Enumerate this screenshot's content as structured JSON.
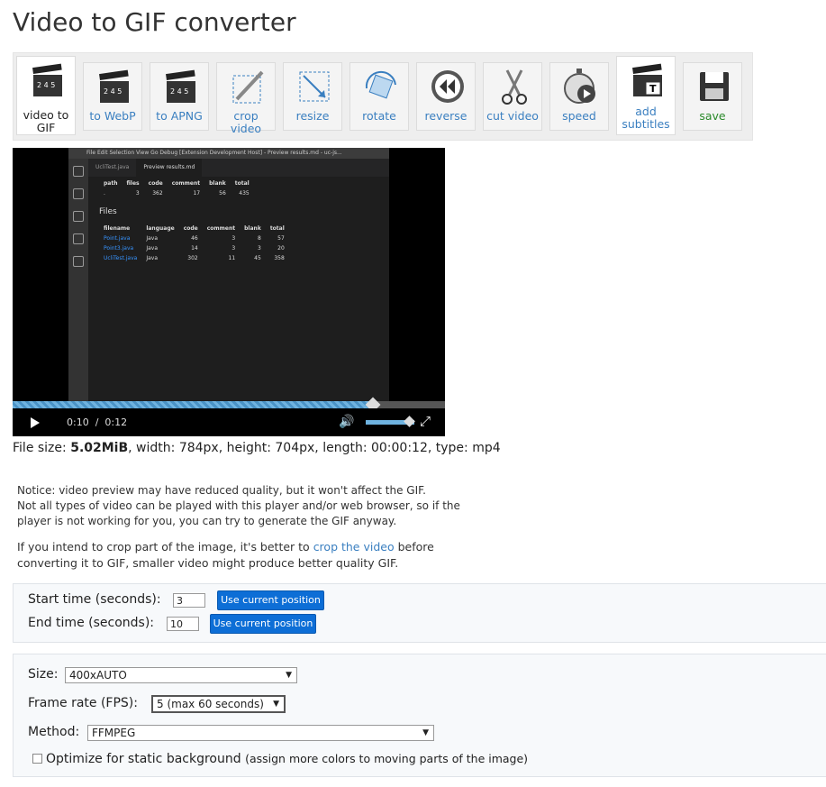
{
  "page": {
    "title": "Video to GIF converter"
  },
  "tools": [
    {
      "label": "video to GIF",
      "icon": "clapperboard-icon"
    },
    {
      "label": "to WebP",
      "icon": "clapperboard-icon"
    },
    {
      "label": "to APNG",
      "icon": "clapperboard-icon"
    },
    {
      "label": "crop video",
      "icon": "crop-icon"
    },
    {
      "label": "resize",
      "icon": "resize-icon"
    },
    {
      "label": "rotate",
      "icon": "rotate-icon"
    },
    {
      "label": "reverse",
      "icon": "reverse-icon"
    },
    {
      "label": "cut video",
      "icon": "scissors-icon"
    },
    {
      "label": "speed",
      "icon": "stopwatch-icon"
    },
    {
      "label": "add subtitles",
      "icon": "subtitles-icon"
    },
    {
      "label": "save",
      "icon": "floppy-disk-icon"
    }
  ],
  "video": {
    "editor_title": "File  Edit  Selection  View  Go  Debug   [Extension Development Host] - Preview results.md - uc-js...",
    "tab1": "UcliTest.java",
    "tab2": "Preview results.md",
    "summary_headers": [
      "path",
      "files",
      "code",
      "comment",
      "blank",
      "total"
    ],
    "summary_row": [
      ".",
      "3",
      "362",
      "17",
      "56",
      "435"
    ],
    "files_title": "Files",
    "files_headers": [
      "filename",
      "language",
      "code",
      "comment",
      "blank",
      "total"
    ],
    "files_rows": [
      [
        "Point.java",
        "Java",
        "46",
        "3",
        "8",
        "57"
      ],
      [
        "Point3.java",
        "Java",
        "14",
        "3",
        "3",
        "20"
      ],
      [
        "UcliTest.java",
        "Java",
        "302",
        "11",
        "45",
        "358"
      ]
    ],
    "current_time": "0:10",
    "separator": "/",
    "duration": "0:12",
    "progress_fraction": 0.833,
    "volume_fraction": 0.9
  },
  "fileinfo": {
    "prefix": "File size: ",
    "size": "5.02MiB",
    "rest": ", width: 784px, height: 704px, length: 00:00:12, type: mp4"
  },
  "notice": {
    "line1": "Notice: video preview may have reduced quality, but it won't affect the GIF.",
    "line2": "Not all types of video can be played with this player and/or web browser, so if the",
    "line3": "player is not working for you, you can try to generate the GIF anyway."
  },
  "crop_note": {
    "before": "If you intend to crop part of the image, it's better to ",
    "link": "crop the video",
    "after": " before",
    "line2": "converting it to GIF, smaller video might produce better quality GIF."
  },
  "time_panel": {
    "start_label": "Start time (seconds):",
    "start_value": "3",
    "end_label": "End time (seconds):",
    "end_value": "10",
    "use_current": "Use current position"
  },
  "options": {
    "size_label": "Size:",
    "size_value": "400xAUTO",
    "fps_label": "Frame rate (FPS):",
    "fps_value": "5 (max 60 seconds)",
    "method_label": "Method:",
    "method_value": "FFMPEG",
    "optimize_label": "Optimize for static background",
    "optimize_hint": "(assign more colors to moving parts of the image)",
    "arrow": "▼"
  }
}
